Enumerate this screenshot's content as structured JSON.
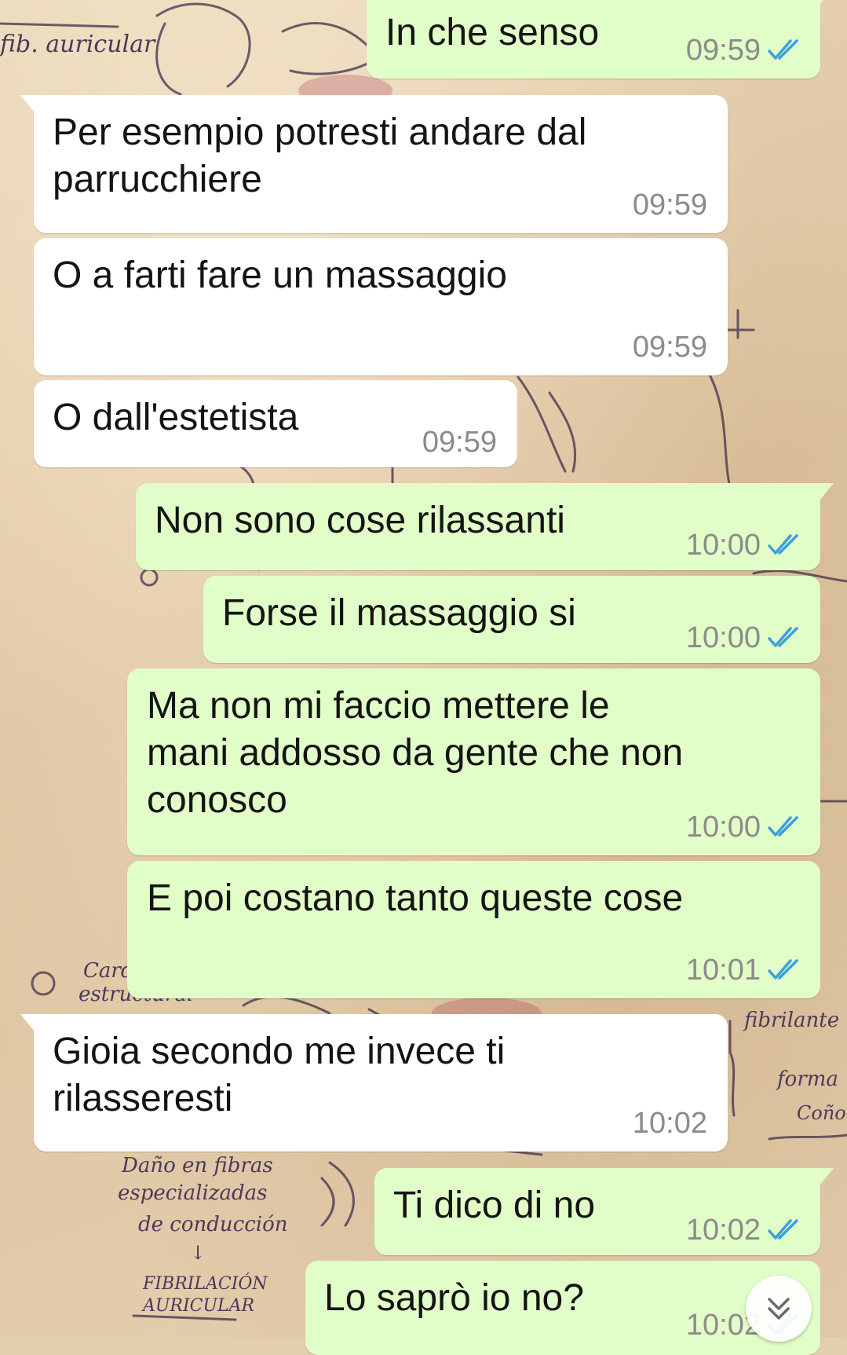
{
  "wallpaper": {
    "annotations": [
      "fib. auricular",
      "Card",
      "estructural",
      "fibrilante",
      "forma",
      "Coño",
      "Daño en fibras",
      "especializadas",
      "de conducción",
      "↓",
      "FIBRILACIÓN",
      "AURICULAR"
    ]
  },
  "colors": {
    "outgoing_bubble": "#e2fec8",
    "incoming_bubble": "#ffffff",
    "read_ticks": "#3ba0e0",
    "timestamp": "#8b8b8b"
  },
  "messages": [
    {
      "direction": "outgoing",
      "text": "In che senso",
      "time": "09:59",
      "status": "read",
      "status_icon": "double-check-icon"
    },
    {
      "direction": "incoming",
      "text": "Per esempio potresti andare dal parrucchiere",
      "lines": [
        "Per esempio potresti andare dal",
        "parrucchiere"
      ],
      "time": "09:59"
    },
    {
      "direction": "incoming",
      "text": "O a farti fare un massaggio",
      "time": "09:59"
    },
    {
      "direction": "incoming",
      "text": "O dall'estetista",
      "time": "09:59"
    },
    {
      "direction": "outgoing",
      "text": "Non sono cose rilassanti",
      "time": "10:00",
      "status": "read",
      "status_icon": "double-check-icon"
    },
    {
      "direction": "outgoing",
      "text": "Forse il massaggio si",
      "time": "10:00",
      "status": "read",
      "status_icon": "double-check-icon"
    },
    {
      "direction": "outgoing",
      "text": "Ma non mi faccio mettere le mani addosso da gente che non conosco",
      "lines": [
        "Ma non mi faccio mettere le",
        "mani addosso da gente che non",
        "conosco"
      ],
      "time": "10:00",
      "status": "read",
      "status_icon": "double-check-icon"
    },
    {
      "direction": "outgoing",
      "text": "E poi costano tanto queste cose",
      "time": "10:01",
      "status": "read",
      "status_icon": "double-check-icon"
    },
    {
      "direction": "incoming",
      "text": "Gioia secondo me invece ti rilasseresti",
      "lines": [
        "Gioia secondo me invece ti",
        "rilasseresti"
      ],
      "time": "10:02"
    },
    {
      "direction": "outgoing",
      "text": "Ti dico di no",
      "time": "10:02",
      "status": "read",
      "status_icon": "double-check-icon"
    },
    {
      "direction": "outgoing",
      "text": "Lo saprò io no?",
      "time": "10:02",
      "status": "read",
      "status_icon": "double-check-icon"
    }
  ],
  "scroll_button": {
    "icon": "double-chevron-down-icon"
  }
}
